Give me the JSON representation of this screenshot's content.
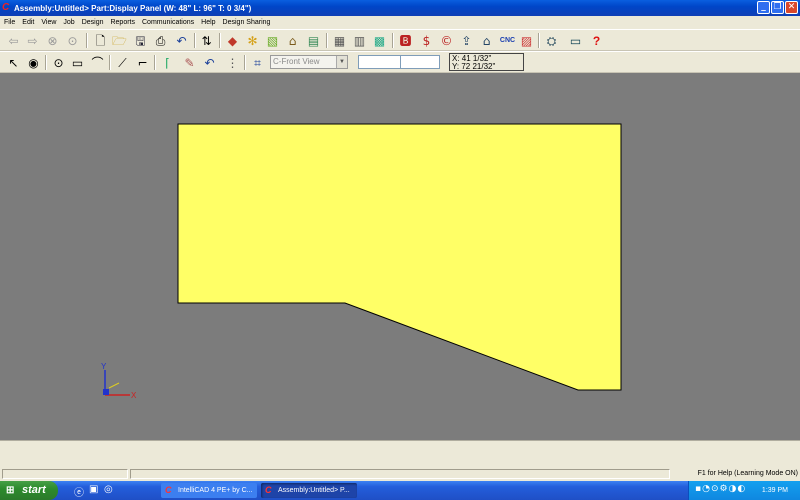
{
  "window": {
    "title": "Assembly:Untitled> Part:Display Panel (W: 48\" L: 96\" T: 0 3/4\")",
    "minimize": "_",
    "maximize": "❐",
    "close": "✕"
  },
  "menu": [
    "File",
    "Edit",
    "View",
    "Job",
    "Design",
    "Reports",
    "Communications",
    "Help",
    "Design Sharing"
  ],
  "toolbar": {
    "cnc_label": "CNC",
    "help_glyph": "?",
    "view_select": "C-Front View",
    "coord_x": "X: 41 1/32\"",
    "coord_y": "Y: 72 21/32\""
  },
  "canvas": {
    "background": "#7c7c7c",
    "panel_fill": "#ffff66",
    "axis_y_label": "Y",
    "axis_x_label": "X"
  },
  "status": {
    "help_text": "F1 for Help (Learning Mode ON)"
  },
  "taskbar": {
    "start_label": "start",
    "items": [
      "IntelliCAD 4 PE+ by C...",
      "Assembly:Untitled> P..."
    ],
    "clock": "1:39 PM"
  }
}
